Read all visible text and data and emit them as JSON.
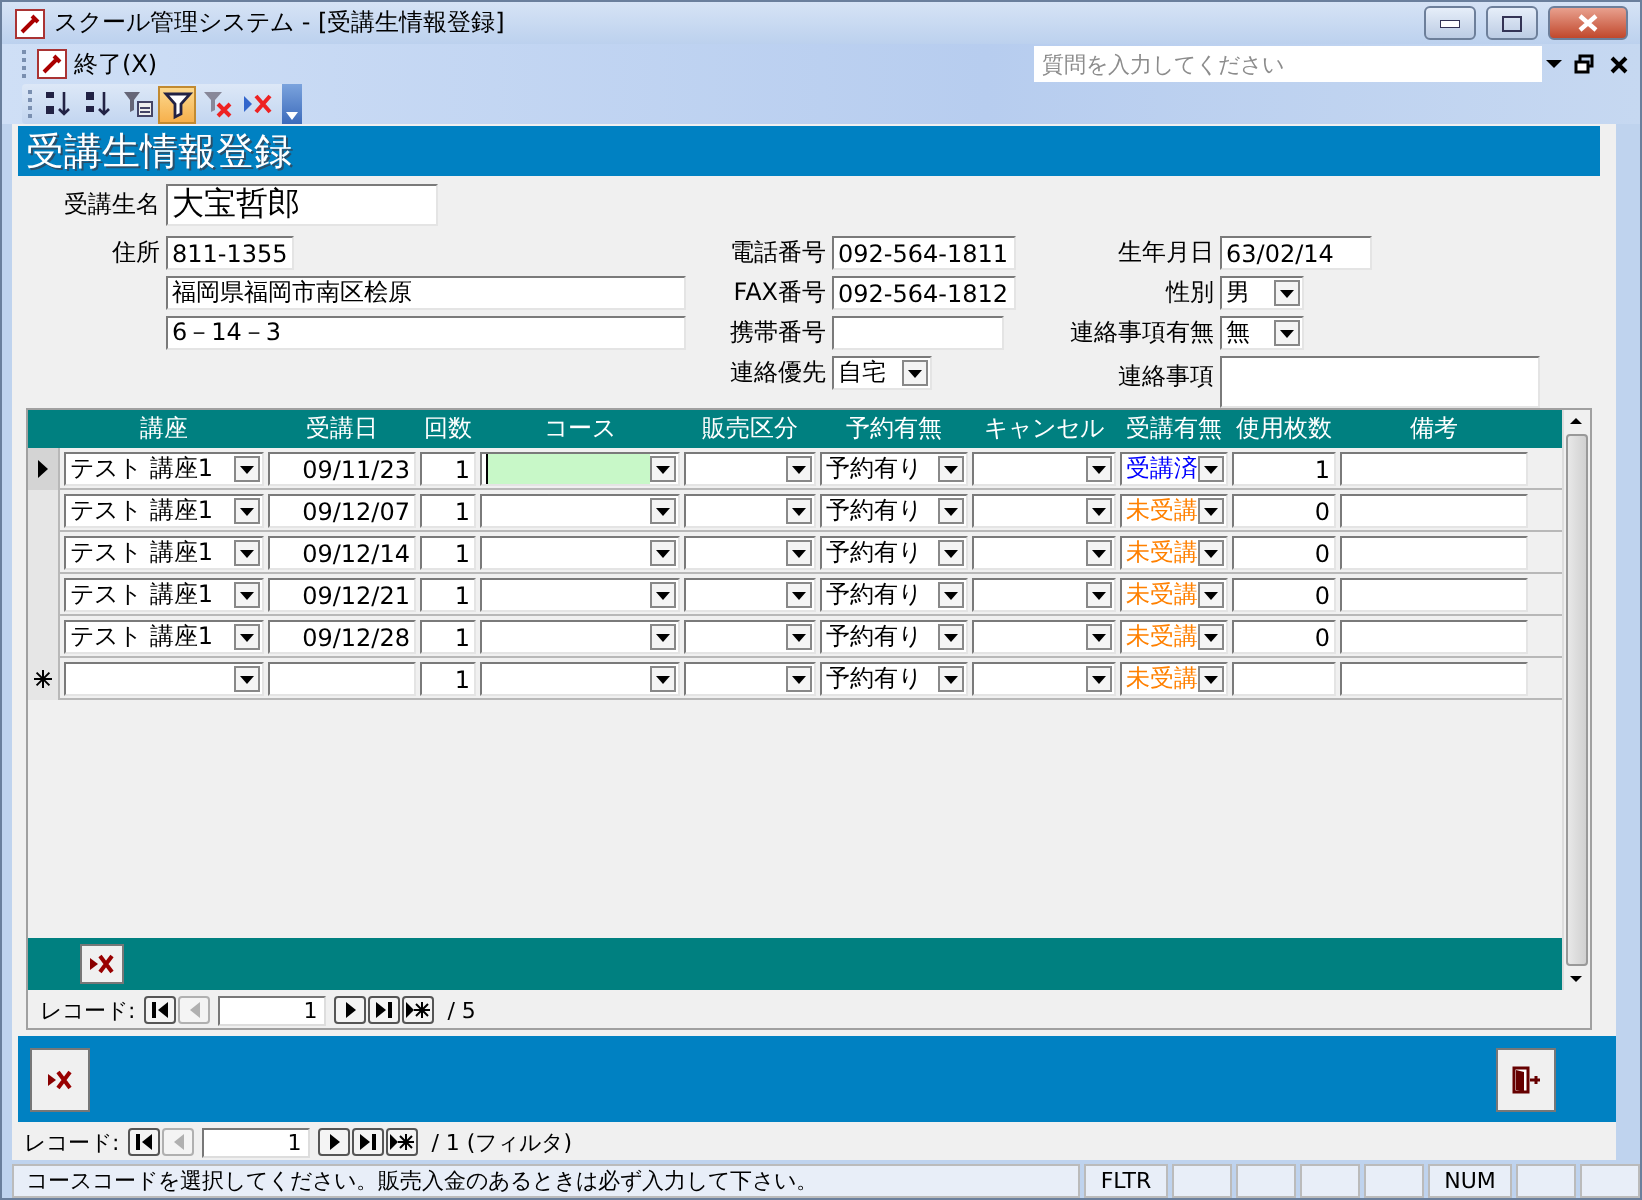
{
  "window": {
    "title": "スクール管理システム - [受講生情報登録]"
  },
  "menu_bar": {
    "items": [
      {
        "label": "終了(X)"
      }
    ],
    "help_search": {
      "placeholder": "質問を入力してください"
    }
  },
  "toolbar": {
    "buttons": [
      {
        "kind": "sort-ascending",
        "selected": false
      },
      {
        "kind": "sort-descending",
        "selected": false
      },
      {
        "kind": "filter-by-form",
        "selected": false
      },
      {
        "kind": "toggle-filter",
        "selected": true
      },
      {
        "kind": "clear-filter",
        "selected": false
      },
      {
        "kind": "delete",
        "selected": false
      }
    ]
  },
  "form_header": {
    "title": "受講生情報登録"
  },
  "student": {
    "name": {
      "label": "受講生名",
      "value": "大宝哲郎"
    },
    "address": {
      "label": "住所",
      "postal_code": "811-1355",
      "line_1": "福岡県福岡市南区桧原",
      "line_2": "6－14－3"
    },
    "phone": {
      "label": "電話番号",
      "value": "092-564-1811"
    },
    "fax": {
      "label": "FAX番号",
      "value": "092-564-1812"
    },
    "mobile": {
      "label": "携帯番号"
    },
    "contact_preference": {
      "label": "連絡優先",
      "value": "自宅"
    },
    "birth_date": {
      "label": "生年月日",
      "value": "63/02/14"
    },
    "gender": {
      "label": "性別",
      "value": "男"
    },
    "has_notes": {
      "label": "連絡事項有無",
      "value": "無"
    },
    "notes": {
      "label": "連絡事項"
    }
  },
  "lessons": {
    "columns": [
      "講座",
      "受講日",
      "回数",
      "コース",
      "販売区分",
      "予約有無",
      "キャンセル",
      "受講有無",
      "使用枚数",
      "備考"
    ],
    "rows": [
      {
        "kind": "record",
        "selected": true,
        "course": "テスト 講座1",
        "date": "09/11/23",
        "count": "1",
        "course_code_focused": true,
        "reservation": "予約有り",
        "attendance": {
          "text": "受講済",
          "color": "#0000ff"
        },
        "tickets_used": "1"
      },
      {
        "kind": "record",
        "selected": false,
        "course": "テスト 講座1",
        "date": "09/12/07",
        "count": "1",
        "course_code_focused": false,
        "reservation": "予約有り",
        "attendance": {
          "text": "未受講",
          "color": "#ff8000"
        },
        "tickets_used": "0"
      },
      {
        "kind": "record",
        "selected": false,
        "course": "テスト 講座1",
        "date": "09/12/14",
        "count": "1",
        "course_code_focused": false,
        "reservation": "予約有り",
        "attendance": {
          "text": "未受講",
          "color": "#ff8000"
        },
        "tickets_used": "0"
      },
      {
        "kind": "record",
        "selected": false,
        "course": "テスト 講座1",
        "date": "09/12/21",
        "count": "1",
        "course_code_focused": false,
        "reservation": "予約有り",
        "attendance": {
          "text": "未受講",
          "color": "#ff8000"
        },
        "tickets_used": "0"
      },
      {
        "kind": "record",
        "selected": false,
        "course": "テスト 講座1",
        "date": "09/12/28",
        "count": "1",
        "course_code_focused": false,
        "reservation": "予約有り",
        "attendance": {
          "text": "未受講",
          "color": "#ff8000"
        },
        "tickets_used": "0"
      },
      {
        "kind": "new",
        "selected": false,
        "count": "1",
        "course_code_focused": false,
        "reservation": "予約有り",
        "attendance": {
          "text": "未受講",
          "color": "#ff8000"
        }
      }
    ],
    "navigation": {
      "label": "レコード:",
      "current": "1",
      "total": "/ 5",
      "buttons": [
        {
          "kind": "first",
          "disabled": false
        },
        {
          "kind": "previous",
          "disabled": true
        },
        {
          "kind": "next",
          "disabled": false
        },
        {
          "kind": "last",
          "disabled": false
        },
        {
          "kind": "new",
          "disabled": false
        }
      ]
    }
  },
  "navigation": {
    "label": "レコード:",
    "current": "1",
    "total": "/ 1 (フィルタ)",
    "buttons": [
      {
        "kind": "first",
        "disabled": false
      },
      {
        "kind": "previous",
        "disabled": true
      },
      {
        "kind": "next",
        "disabled": false
      },
      {
        "kind": "last",
        "disabled": false
      },
      {
        "kind": "new",
        "disabled": false
      }
    ]
  },
  "status_bar": {
    "message": "コースコードを選択してください。販売入金のあるときは必ず入力して下さい。",
    "indicators": [
      "FLTR",
      "NUM"
    ]
  }
}
